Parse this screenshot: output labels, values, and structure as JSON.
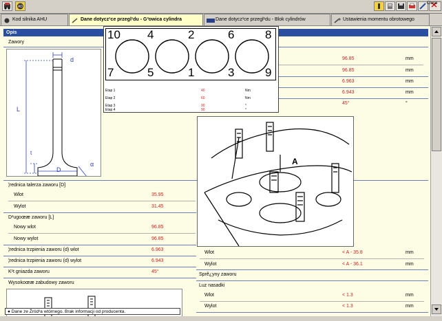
{
  "toolbar": {
    "close_label": "Close",
    "left_icons": [
      "car-icon",
      "engine-icon"
    ],
    "right_icons": [
      "info-icon",
      "book-icon",
      "save-icon",
      "print-icon",
      "pen-icon",
      "printer-icon",
      "help-icon"
    ]
  },
  "tabs": [
    {
      "label": "Kod silnika AHU",
      "icon": "engine-icon",
      "active": false
    },
    {
      "label": "Dane dotycz¹ce przegl¹du - G³owica cylindra",
      "icon": "wrench-icon",
      "active": true
    },
    {
      "label": "Dane dotycz¹ce przegl¹du - Blok cylindrów",
      "icon": "block-icon",
      "active": false
    },
    {
      "label": "Ustawienia momentu obrotowego",
      "icon": "torque-icon",
      "active": false
    }
  ],
  "section_header": "Opis",
  "valves_label": "Zawory",
  "valve_diagram_labels": {
    "d": "d",
    "L": "L",
    "t": "t",
    "D": "D",
    "alpha": "α"
  },
  "left_rows": [
    {
      "label": "¦rednica talerza zaworu [D]",
      "value": "",
      "unit": "",
      "indent": false
    },
    {
      "label": "Wlot",
      "value": "35.95",
      "unit": "mm",
      "indent": true
    },
    {
      "label": "Wylot",
      "value": "31.45",
      "unit": "mm",
      "indent": true
    },
    {
      "label": "D³ugoœæ zaworu [L]",
      "value": "",
      "unit": "",
      "indent": false
    },
    {
      "label": "Nowy wlot",
      "value": "96.85",
      "unit": "mm",
      "indent": true
    },
    {
      "label": "Nowy wylot",
      "value": "96.85",
      "unit": "mm",
      "indent": true
    },
    {
      "label": "¦rednica trzpienia zaworu (d) wlot",
      "value": "6.963",
      "unit": "mm",
      "indent": false
    },
    {
      "label": "¦rednica trzpienia zaworu (d) wylot",
      "value": "6.943",
      "unit": "mm",
      "indent": false
    },
    {
      "label": "K¹t gniazda zaworu",
      "value": "45°",
      "unit": "°",
      "indent": false
    },
    {
      "label": "Wysokoœæ zabudowy zaworu",
      "value": "",
      "unit": "",
      "indent": false
    }
  ],
  "right_top_rows": [
    {
      "value": "96.85",
      "unit": "mm"
    },
    {
      "value": "96.85",
      "unit": "mm"
    },
    {
      "value": "6.963",
      "unit": "mm"
    },
    {
      "value": "6.943",
      "unit": "mm"
    },
    {
      "value": "45°",
      "unit": "°"
    }
  ],
  "bolt_sequence": {
    "numbers": [
      "10",
      "4",
      "2",
      "6",
      "8",
      "7",
      "5",
      "1",
      "3",
      "9"
    ],
    "stages": [
      {
        "label": "Etap 1",
        "value": "40",
        "unit": "Nm"
      },
      {
        "label": "Etap 2",
        "value": "60",
        "unit": "Nm"
      },
      {
        "label": "Etap 3",
        "value": "90",
        "unit": "°"
      },
      {
        "label": "Etap 4",
        "value": "90",
        "unit": "°"
      }
    ]
  },
  "head_diagram_label": "A",
  "right_bottom_rows": [
    {
      "label": "Wlot",
      "value": "< A - 35.8",
      "unit": "mm",
      "indent": true
    },
    {
      "label": "Wylot",
      "value": "< A - 36.1",
      "unit": "mm",
      "indent": true
    },
    {
      "label": "Sprê¿yny zaworu",
      "value": "",
      "unit": "",
      "indent": false
    },
    {
      "label": "Luz nasadki",
      "value": "",
      "unit": "",
      "indent": false
    },
    {
      "label": "Wlot",
      "value": "< 1.3",
      "unit": "mm",
      "indent": true
    },
    {
      "label": "Wylot",
      "value": "< 1.3",
      "unit": "mm",
      "indent": true
    }
  ],
  "status_text": "Dane ze Źród³a wtórnego. Brak informacji od producenta."
}
